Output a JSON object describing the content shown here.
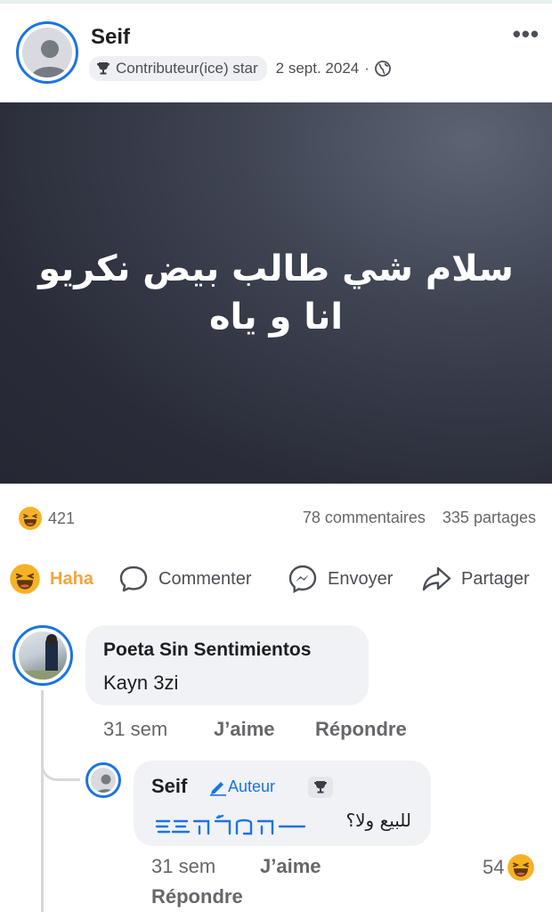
{
  "post": {
    "author": "Seif",
    "badge_label": "Contributeur(ice) star",
    "date": "2 sept. 2024",
    "separator": "·",
    "more_label": "•••",
    "text_line1": "سلام شي طالب بيض نكريو",
    "text_line2": "انا و ياه",
    "background_color": "#2b2e3a",
    "reaction_count": "421",
    "comments_count": "78 commentaires",
    "shares_count": "335 partages"
  },
  "actions": {
    "haha": "Haha",
    "comment": "Commenter",
    "send": "Envoyer",
    "share": "Partager",
    "haha_color": "#f2a53c"
  },
  "comment": {
    "author": "Poeta Sin Sentimientos",
    "text": "Kayn 3zi",
    "time": "31 sem",
    "like": "J’aime",
    "reply": "Répondre"
  },
  "reply": {
    "author": "Seif",
    "author_badge": "Auteur",
    "text": "للبيع ولا؟",
    "time": "31 sem",
    "like": "J’aime",
    "reply": "Répondre",
    "reaction_count": "54"
  },
  "colors": {
    "accent": "#1b74e4",
    "muted_text": "#65676b",
    "bubble": "#f0f2f5"
  }
}
